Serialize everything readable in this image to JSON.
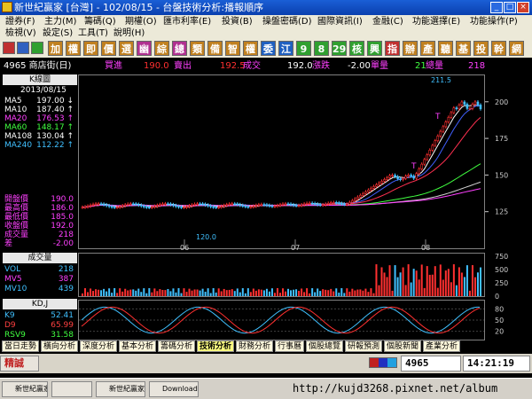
{
  "window": {
    "title": "新世紀贏家 [台灣] - 102/08/15 - 台盤技術分析:播報順序"
  },
  "menu": [
    "證券(F)",
    "主力(M)",
    "籌碼(Q)",
    "期權(O)",
    "匯市利率(E)",
    "投資(B)",
    "操盤密碼(D)",
    "國際資訊(I)",
    "金融(C)",
    "功能選擇(E)",
    "功能操作(P)",
    "檢視(V)",
    "設定(S)",
    "工具(T)",
    "說明(H)"
  ],
  "toolbar": [
    {
      "label": "加",
      "color": "#c08020"
    },
    {
      "label": "權",
      "color": "#c08020"
    },
    {
      "label": "即",
      "color": "#c08020"
    },
    {
      "label": "價",
      "color": "#c08020"
    },
    {
      "label": "選",
      "color": "#c08020"
    },
    {
      "label": "幽",
      "color": "#b03090"
    },
    {
      "label": "綜",
      "color": "#c08020"
    },
    {
      "label": "總",
      "color": "#b03090"
    },
    {
      "label": "類",
      "color": "#c08020"
    },
    {
      "label": "備",
      "color": "#c08020"
    },
    {
      "label": "智",
      "color": "#c08020"
    },
    {
      "label": "權",
      "color": "#c08020"
    },
    {
      "label": "委",
      "color": "#2060c0"
    },
    {
      "label": "江",
      "color": "#2060c0"
    },
    {
      "label": "9",
      "color": "#30a030"
    },
    {
      "label": "8",
      "color": "#30a030"
    },
    {
      "label": "29",
      "color": "#30a030"
    },
    {
      "label": "核",
      "color": "#30a030"
    },
    {
      "label": "興",
      "color": "#30a030"
    },
    {
      "label": "指",
      "color": "#c03030"
    },
    {
      "label": "辦",
      "color": "#c08020"
    },
    {
      "label": "產",
      "color": "#c08020"
    },
    {
      "label": "聽",
      "color": "#c08020"
    },
    {
      "label": "基",
      "color": "#c08020"
    },
    {
      "label": "投",
      "color": "#c08020"
    },
    {
      "label": "幹",
      "color": "#c08020"
    },
    {
      "label": "網",
      "color": "#c08020"
    }
  ],
  "quote": {
    "stock": "4965 商店街(日)",
    "buy_label": "買進",
    "buy": "190.0",
    "sell_label": "賣出",
    "sell": "192.5",
    "last_label": "成交",
    "last": "192.0",
    "change_label": "漲跌",
    "change": "-2.00",
    "vol_label": "單量",
    "vol": "21",
    "total_label": "總量",
    "total": "218"
  },
  "kpanel": {
    "title": "K線圖",
    "date": "2013/08/15",
    "ma": [
      {
        "name": "MA5",
        "value": "197.00",
        "arrow": "↓",
        "color": "#ffffff"
      },
      {
        "name": "MA10",
        "value": "187.40",
        "arrow": "↑",
        "color": "#ffffff"
      },
      {
        "name": "MA20",
        "value": "176.53",
        "arrow": "↑",
        "color": "#ff40ff"
      },
      {
        "name": "MA60",
        "value": "148.17",
        "arrow": "↑",
        "color": "#40ff40"
      },
      {
        "name": "MA108",
        "value": "130.04",
        "arrow": "↑",
        "color": "#ffffff"
      },
      {
        "name": "MA240",
        "value": "112.22",
        "arrow": "↑",
        "color": "#40c0ff"
      }
    ],
    "ohlc": [
      {
        "name": "開盤價",
        "value": "190.0"
      },
      {
        "name": "最高價",
        "value": "186.0"
      },
      {
        "name": "最低價",
        "value": "185.0"
      },
      {
        "name": "收盤價",
        "value": "192.0"
      },
      {
        "name": "成交量",
        "value": "218"
      },
      {
        "name": "差",
        "value": "-2.00"
      }
    ]
  },
  "vpanel": {
    "title": "成交量",
    "rows": [
      {
        "name": "VOL",
        "value": "218",
        "color": "#40c0ff"
      },
      {
        "name": "MV5",
        "value": "387",
        "color": "#ff40ff"
      },
      {
        "name": "MV10",
        "value": "439",
        "color": "#40c0ff"
      }
    ]
  },
  "kdpanel": {
    "title": "KD,J",
    "rows": [
      {
        "name": "K9",
        "value": "52.41",
        "color": "#40c0ff"
      },
      {
        "name": "D9",
        "value": "65.99",
        "color": "#ff4040"
      },
      {
        "name": "RSV9",
        "value": "31.58",
        "color": "#40ff40"
      }
    ]
  },
  "chart_data": [
    {
      "type": "candlestick",
      "title": "K線圖",
      "x_ticks": [
        "06",
        "07",
        "08"
      ],
      "y_ticks": [
        125,
        150,
        175,
        200
      ],
      "annotations": [
        "211.5",
        "120.0",
        "T",
        "T"
      ],
      "series_color": {
        "up": "#ff3030",
        "down": "#40c0ff"
      }
    },
    {
      "type": "bar",
      "title": "成交量",
      "y_ticks": [
        0,
        250,
        500,
        750
      ]
    },
    {
      "type": "line",
      "title": "KD,J",
      "y_ticks": [
        20,
        50,
        80
      ]
    }
  ],
  "tabs": [
    "當日走勢",
    "橫向分析",
    "深度分析",
    "基本分析",
    "籌碼分析",
    "技術分析",
    "財務分析",
    "行事曆",
    "個股總覽",
    "研報預測",
    "個股新聞",
    "產業分析"
  ],
  "status": {
    "left": "精誠",
    "stock": "4965",
    "time": "14:21:19"
  },
  "taskbar": {
    "items": [
      "新世紀贏家",
      "",
      "新世紀贏家",
      "Downloads"
    ],
    "url": "http://kujd3268.pixnet.net/album"
  }
}
